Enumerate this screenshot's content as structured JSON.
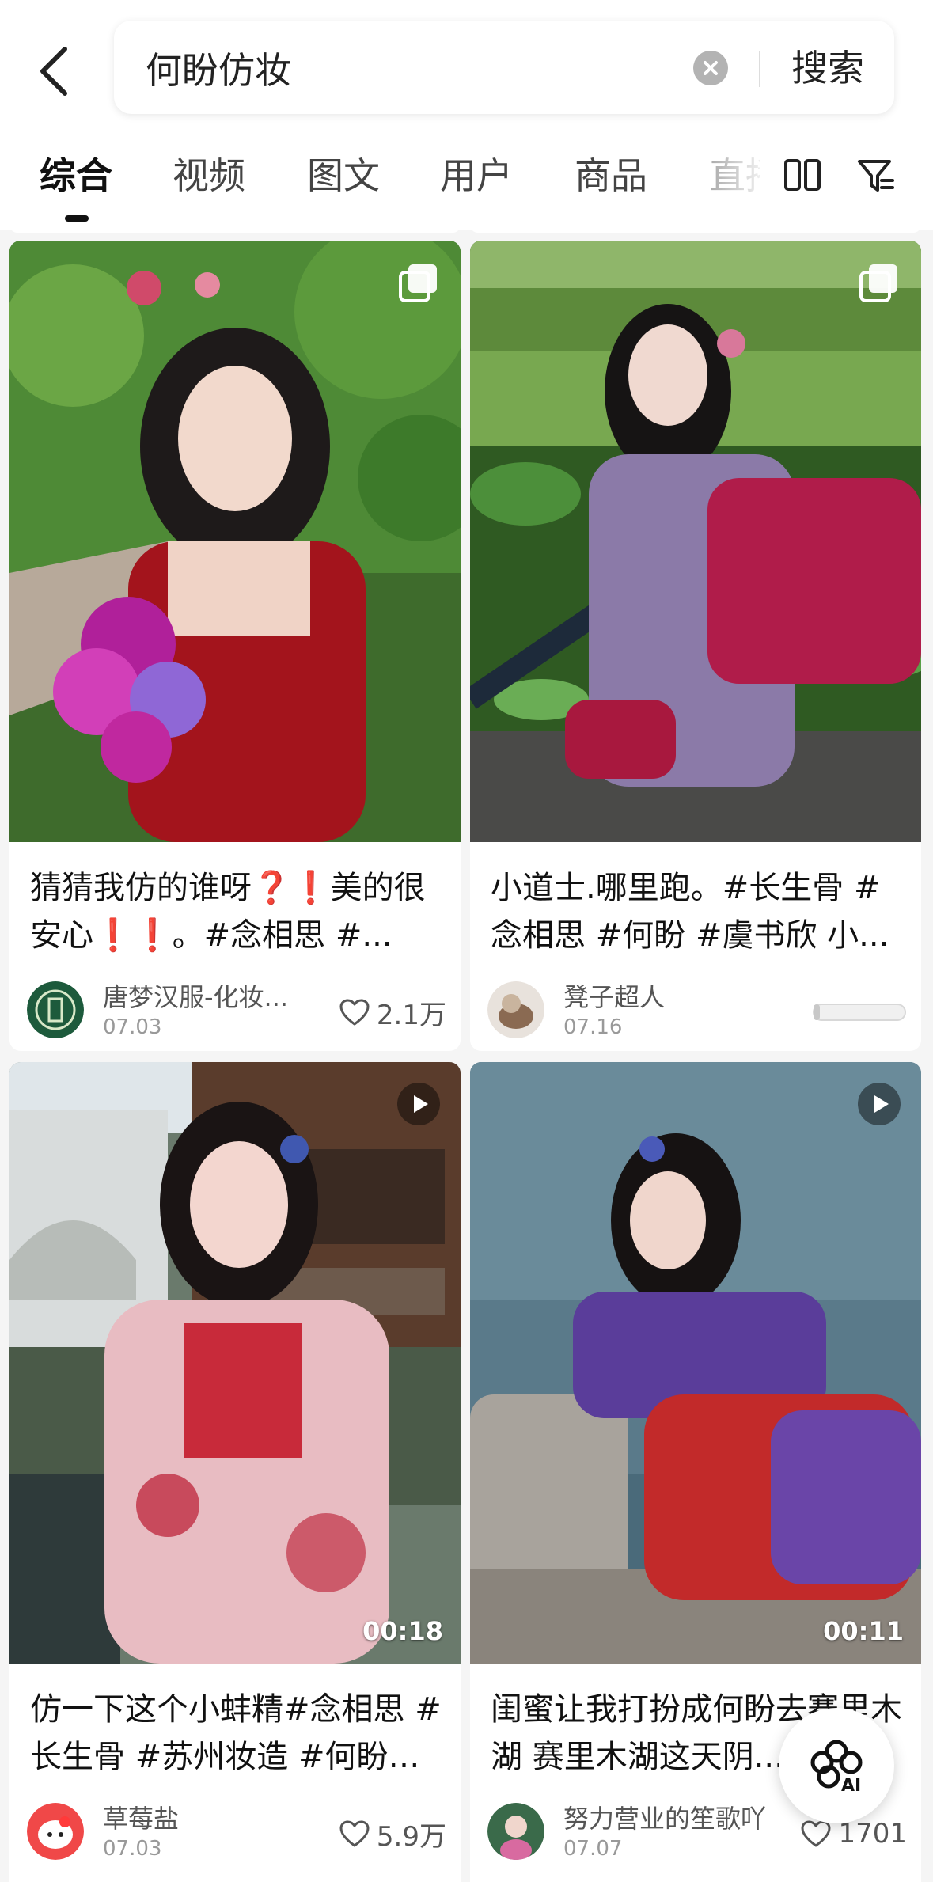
{
  "search": {
    "query": "何盼仿妆",
    "button_label": "搜索"
  },
  "tabs": [
    {
      "label": "综合",
      "active": true
    },
    {
      "label": "视频"
    },
    {
      "label": "图文"
    },
    {
      "label": "用户"
    },
    {
      "label": "商品"
    },
    {
      "label": "直播"
    }
  ],
  "cards": [
    {
      "title": "猜猜我仿的谁呀❓❗美的很安心❗❗。#念相思 #...",
      "author": "唐梦汉服-化妆...",
      "date": "07.03",
      "likes": "2.1万",
      "badge": "images-icon"
    },
    {
      "title": "小道士.哪里跑。#长生骨 #念相思 #何盼 #虞书欣 小...",
      "author": "凳子超人",
      "date": "07.16",
      "likes": "",
      "badge": "images-icon"
    },
    {
      "title": "仿一下这个小蚌精#念相思 #长生骨 #苏州妆造 #何盼#...",
      "author": "草莓盐",
      "date": "07.03",
      "likes": "5.9万",
      "duration": "00:18",
      "badge": "play-icon"
    },
    {
      "title": "闺蜜让我打扮成何盼去赛里木湖 赛里木湖这天阴...",
      "author": "努力营业的笙歌吖",
      "date": "07.07",
      "likes": "1701",
      "duration": "00:11",
      "badge": "play-icon"
    }
  ],
  "ai_button": {
    "label": "AI"
  },
  "colors": {
    "background": "#f5f5f5",
    "text": "#111111",
    "muted": "#999999"
  }
}
